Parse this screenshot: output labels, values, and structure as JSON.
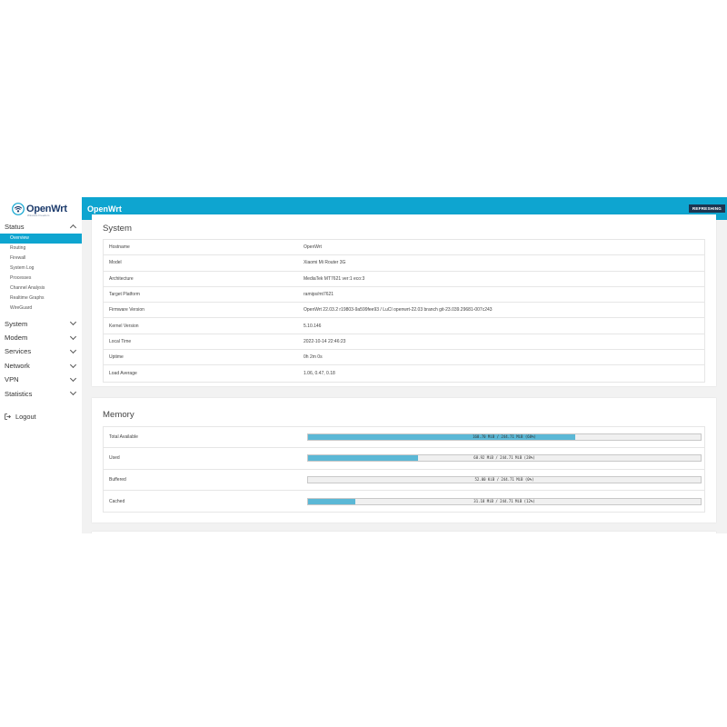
{
  "header": {
    "brand_name": "OpenWrt",
    "brand_tagline": "Wireless Freedom",
    "title": "OpenWrt",
    "refresh_label": "REFRESHING"
  },
  "sidebar": {
    "status_label": "Status",
    "status_items": [
      "Overview",
      "Routing",
      "Firewall",
      "System Log",
      "Processes",
      "Channel Analysis",
      "Realtime Graphs",
      "WireGuard"
    ],
    "active_item": "Overview",
    "groups": [
      "System",
      "Modem",
      "Services",
      "Network",
      "VPN",
      "Statistics"
    ],
    "logout_label": "Logout"
  },
  "system": {
    "title": "System",
    "rows": [
      {
        "key": "Hostname",
        "value": "OpenWrt"
      },
      {
        "key": "Model",
        "value": "Xiaomi Mi Router 3G"
      },
      {
        "key": "Architecture",
        "value": "MediaTek MT7621 ver:1 eco:3"
      },
      {
        "key": "Target Platform",
        "value": "ramips/mt7621"
      },
      {
        "key": "Firmware Version",
        "value": "OpenWrt 22.03.2 r19803-9a599fee93 / LuCI openwrt-22.03 branch git-23.039.29681-007c243"
      },
      {
        "key": "Kernel Version",
        "value": "5.10.146"
      },
      {
        "key": "Local Time",
        "value": "2022-10-14 22:46:23"
      },
      {
        "key": "Uptime",
        "value": "0h 2m 0s"
      },
      {
        "key": "Load Average",
        "value": "1.06, 0.47, 0.18"
      }
    ]
  },
  "memory": {
    "title": "Memory",
    "rows": [
      {
        "key": "Total Available",
        "label": "168.70 MiB / 244.71 MiB (68%)",
        "fraction": 0.68
      },
      {
        "key": "Used",
        "label": "68.92 MiB / 244.71 MiB (28%)",
        "fraction": 0.28
      },
      {
        "key": "Buffered",
        "label": "52.00 KiB / 244.71 MiB (0%)",
        "fraction": 0.0
      },
      {
        "key": "Cached",
        "label": "31.18 MiB / 244.71 MiB (12%)",
        "fraction": 0.12
      }
    ]
  },
  "colors": {
    "accent": "#0ea5d0",
    "bar_fill": "#5bb8d6",
    "badge": "#1d3550"
  }
}
